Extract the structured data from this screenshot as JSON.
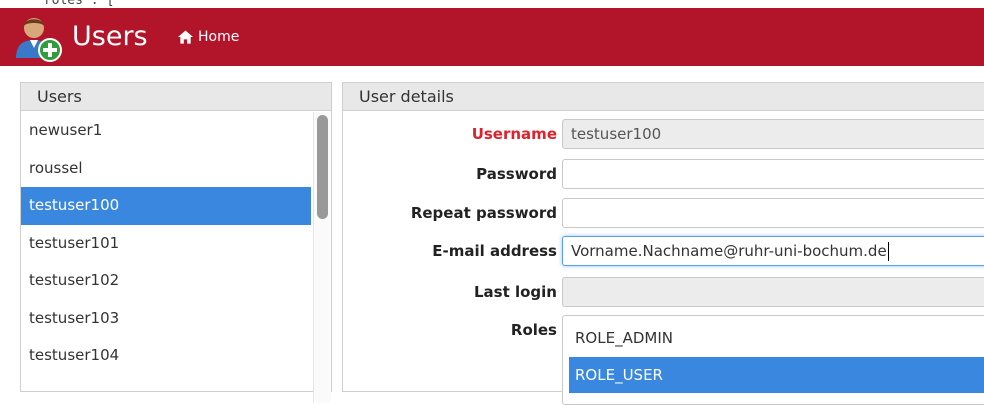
{
  "clip_text": "\"roles\": [",
  "header": {
    "title": "Users",
    "home_label": "Home",
    "background": "#b2142a"
  },
  "users_panel": {
    "title": "Users",
    "items": [
      {
        "name": "newuser1",
        "selected": false
      },
      {
        "name": "roussel",
        "selected": false
      },
      {
        "name": "testuser100",
        "selected": true
      },
      {
        "name": "testuser101",
        "selected": false
      },
      {
        "name": "testuser102",
        "selected": false
      },
      {
        "name": "testuser103",
        "selected": false
      },
      {
        "name": "testuser104",
        "selected": false
      }
    ]
  },
  "details_panel": {
    "title": "User details",
    "username": {
      "label": "Username",
      "value": "testuser100"
    },
    "password": {
      "label": "Password",
      "value": ""
    },
    "repeat_password": {
      "label": "Repeat password",
      "value": ""
    },
    "email": {
      "label": "E-mail address",
      "value": "Vorname.Nachname@ruhr-uni-bochum.de"
    },
    "last_login": {
      "label": "Last login",
      "value": ""
    },
    "roles": {
      "label": "Roles",
      "options": [
        {
          "name": "ROLE_ADMIN",
          "selected": false
        },
        {
          "name": "ROLE_USER",
          "selected": true
        }
      ]
    }
  },
  "colors": {
    "selection": "#3a87e0",
    "required_label": "#e0202a"
  }
}
